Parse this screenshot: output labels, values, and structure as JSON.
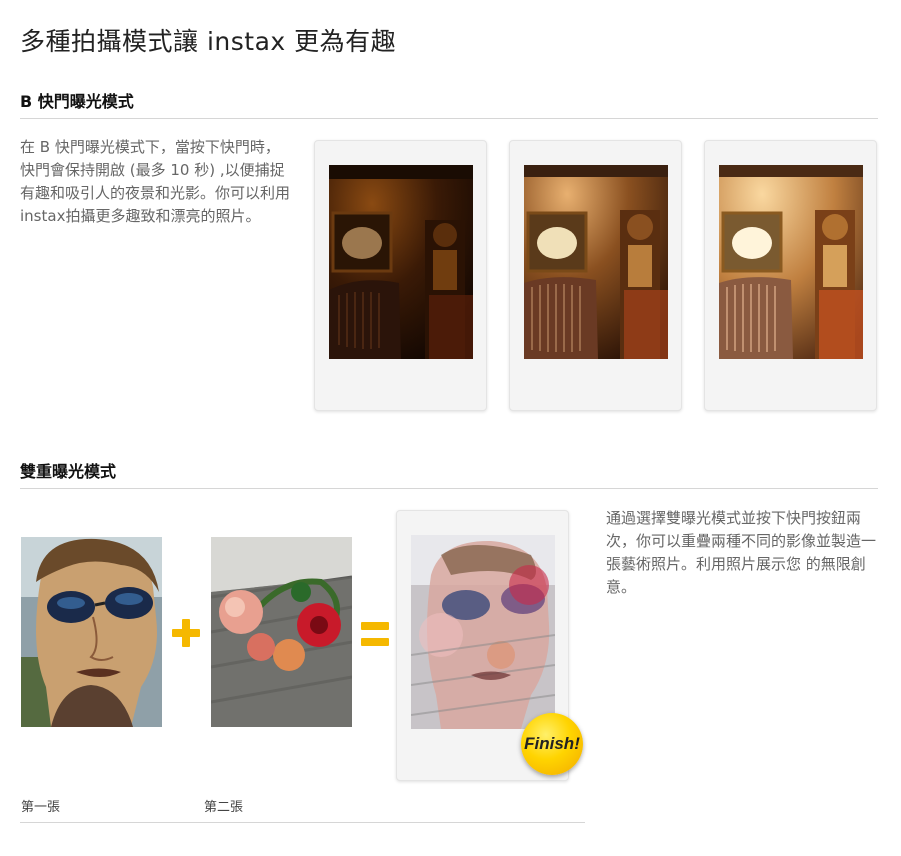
{
  "page": {
    "title": "多種拍攝模式讓 instax 更為有趣"
  },
  "bulb_mode": {
    "heading": "B 快門曝光模式",
    "description": "在 B 快門曝光模式下，當按下快門時，快門會保持開啟 (最多 10 秒) ,以便捕捉有趣和吸引人的夜景和光影。你可以利用instax拍攝更多趣致和漂亮的照片。",
    "photos": [
      {
        "name": "interior-photo-dark",
        "brightness": "dark"
      },
      {
        "name": "interior-photo-medium",
        "brightness": "medium"
      },
      {
        "name": "interior-photo-bright",
        "brightness": "bright"
      }
    ]
  },
  "double_exposure": {
    "heading": "雙重曝光模式",
    "description": "通過選擇雙曝光模式並按下快門按鈕兩次，你可以重疊兩種不同的影像並製造一張藝術照片。利用照片展示您 的無限創意。",
    "first_caption": "第一張",
    "second_caption": "第二張",
    "badge_label": "Finish!",
    "operator_plus_color": "#f5b800",
    "operator_equals_color": "#f5b800"
  }
}
